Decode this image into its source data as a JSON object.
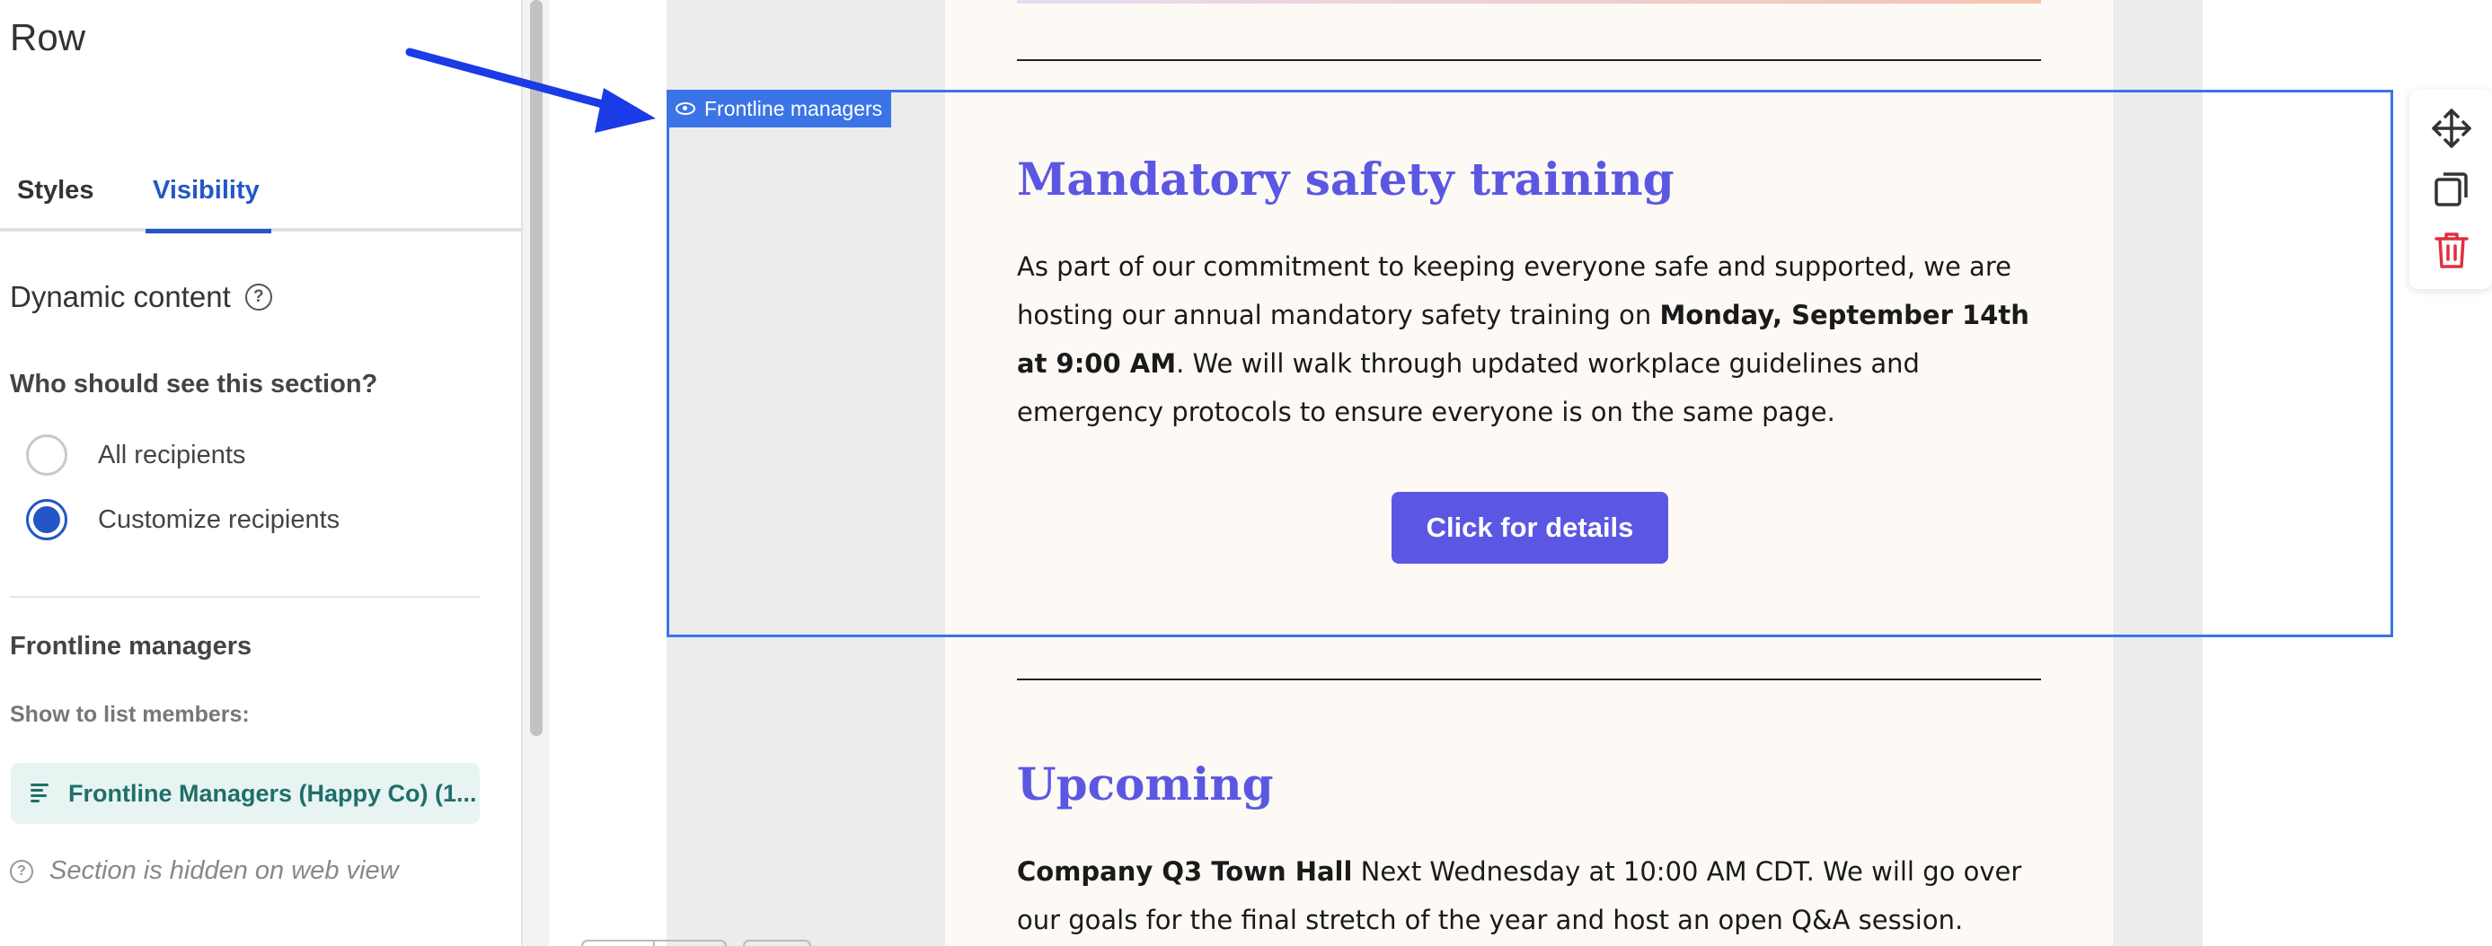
{
  "panel": {
    "title": "Row",
    "tabs": [
      {
        "label": "Styles",
        "active": false
      },
      {
        "label": "Visibility",
        "active": true
      }
    ],
    "dynamic_content": "Dynamic content",
    "question": "Who should see this section?",
    "options": [
      {
        "label": "All recipients",
        "selected": false
      },
      {
        "label": "Customize recipients",
        "selected": true
      }
    ],
    "segment_title": "Frontline managers",
    "show_label": "Show to list members:",
    "list_chip": "Frontline Managers (Happy Co) (1...",
    "hidden_note": "Section is hidden on web view"
  },
  "selection": {
    "tag": "Frontline managers"
  },
  "email": {
    "section1": {
      "heading": "Mandatory safety training",
      "p_a": "As part of our commitment to keeping everyone safe and supported, we are hosting our annual mandatory safety training on ",
      "p_bold": "Monday, September 14th at 9:00 AM",
      "p_b": ". We will walk through updated workplace guidelines and emergency protocols to ensure everyone is on the same page.",
      "button": "Click for details"
    },
    "section2": {
      "heading": "Upcoming",
      "p_bold": "Company Q3 Town Hall",
      "p_rest": " Next Wednesday at 10:00 AM CDT. We will go over our goals for the final stretch of the year and host an open Q&A session."
    }
  },
  "colors": {
    "accent": "#2457c5",
    "selection": "#3b74e6",
    "heading": "#5b57e3",
    "delete": "#e0303e",
    "chip_bg": "#e8f4f2",
    "chip_text": "#1f6f6a"
  },
  "icons": [
    "help-circle-icon",
    "list-icon",
    "eye-icon",
    "move-icon",
    "duplicate-icon",
    "trash-icon",
    "arrow-annotation"
  ]
}
